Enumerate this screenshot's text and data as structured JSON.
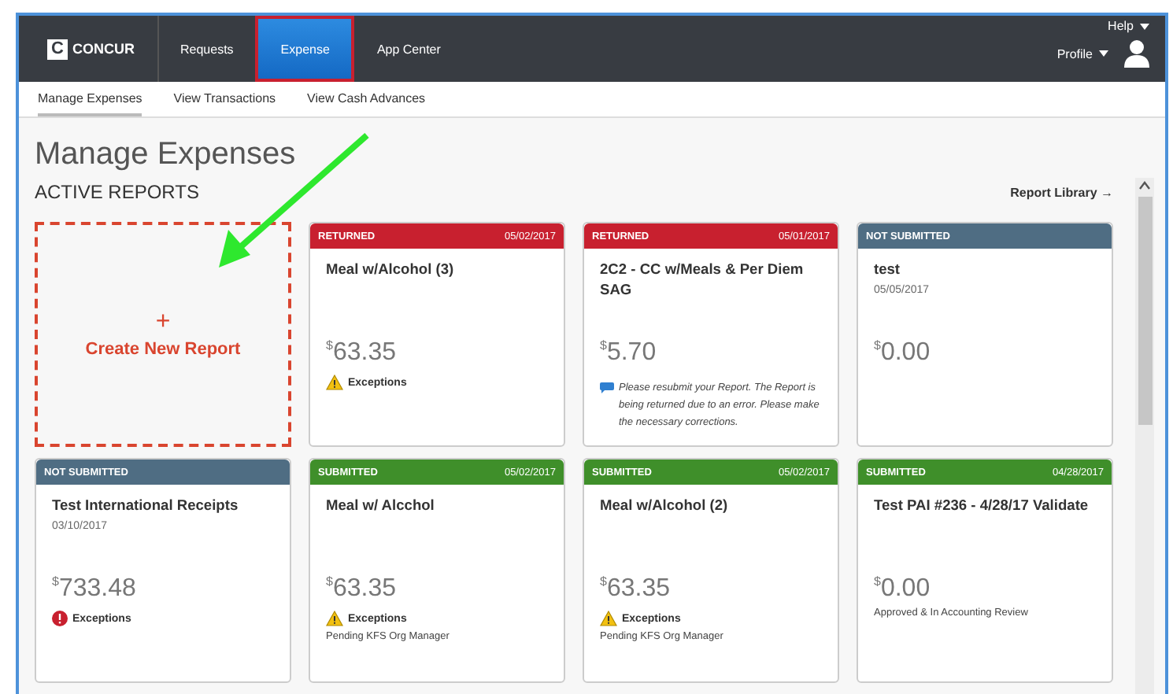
{
  "topbar": {
    "logo_mark": "C",
    "logo_text": "CONCUR",
    "nav": [
      {
        "label": "Requests",
        "selected": false,
        "highlighted": false
      },
      {
        "label": "Expense",
        "selected": true,
        "highlighted": true
      },
      {
        "label": "App Center",
        "selected": false,
        "highlighted": false
      }
    ],
    "help": "Help",
    "profile": "Profile"
  },
  "subnav": [
    {
      "label": "Manage Expenses",
      "selected": true
    },
    {
      "label": "View Transactions",
      "selected": false
    },
    {
      "label": "View Cash Advances",
      "selected": false
    }
  ],
  "page_title": "Manage Expenses",
  "section_title": "ACTIVE REPORTS",
  "report_library": "Report Library →",
  "cards": [
    {
      "kind": "create",
      "plus": "+",
      "label": "Create New Report"
    },
    {
      "kind": "report",
      "status": "RETURNED",
      "color": "#c8202f",
      "date": "05/02/2017",
      "title": "Meal w/Alcohol (3)",
      "currency": "$",
      "amount": "63.35",
      "exception": {
        "kind": "warning",
        "label": "Exceptions"
      }
    },
    {
      "kind": "report",
      "status": "RETURNED",
      "color": "#c8202f",
      "date": "05/01/2017",
      "title": "2C2 - CC w/Meals & Per Diem SAG",
      "currency": "$",
      "amount": "5.70",
      "note": "Please resubmit your Report.  The Report is being returned due to an error. Please make the necessary corrections."
    },
    {
      "kind": "report",
      "status": "NOT SUBMITTED",
      "color": "#4f6d83",
      "title": "test",
      "subdate": "05/05/2017",
      "currency": "$",
      "amount": "0.00"
    },
    {
      "kind": "report",
      "status": "NOT SUBMITTED",
      "color": "#4f6d83",
      "title": "Test International Receipts",
      "subdate": "03/10/2017",
      "currency": "$",
      "amount": "733.48",
      "exception": {
        "kind": "error",
        "label": "Exceptions"
      }
    },
    {
      "kind": "report",
      "status": "SUBMITTED",
      "color": "#3f8f2a",
      "date": "05/02/2017",
      "title": "Meal w/ Alcchol",
      "currency": "$",
      "amount": "63.35",
      "exception": {
        "kind": "warning",
        "label": "Exceptions"
      },
      "workflow": "Pending KFS Org Manager"
    },
    {
      "kind": "report",
      "status": "SUBMITTED",
      "color": "#3f8f2a",
      "date": "05/02/2017",
      "title": "Meal w/Alcohol (2)",
      "currency": "$",
      "amount": "63.35",
      "exception": {
        "kind": "warning",
        "label": "Exceptions"
      },
      "workflow": "Pending KFS Org Manager"
    },
    {
      "kind": "report",
      "status": "SUBMITTED",
      "color": "#3f8f2a",
      "date": "04/28/2017",
      "title": "Test PAI #236 - 4/28/17 Validate",
      "currency": "$",
      "amount": "0.00",
      "workflow": "Approved & In Accounting Review"
    }
  ]
}
